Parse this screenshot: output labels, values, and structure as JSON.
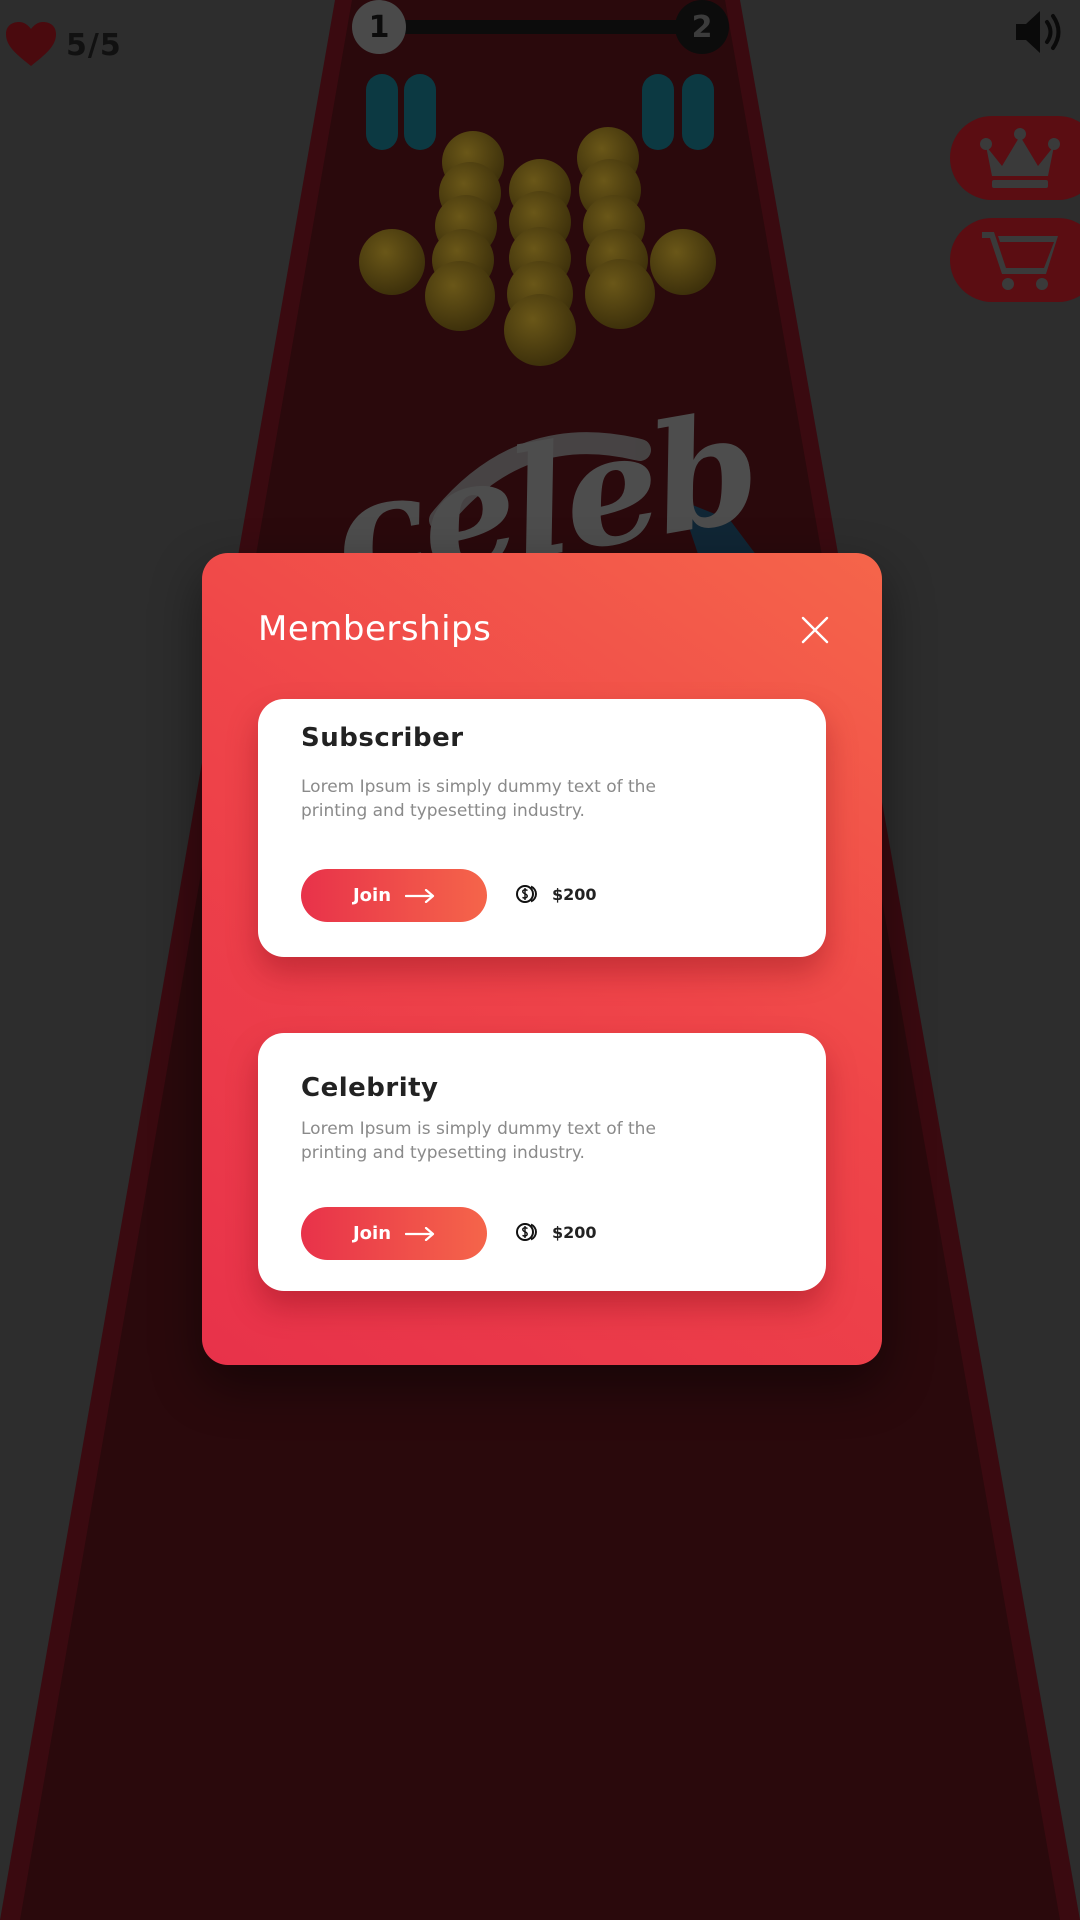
{
  "hud": {
    "lives": "5/5",
    "level_current": "1",
    "level_next": "2"
  },
  "background": {
    "logo_text": "celeb"
  },
  "modal": {
    "title": "Memberships",
    "cards": [
      {
        "title": "Subscriber",
        "description": "Lorem Ipsum is simply dummy text of the printing and typesetting industry.",
        "button_label": "Join",
        "price": "$200"
      },
      {
        "title": "Celebrity",
        "description": "Lorem Ipsum is simply dummy text of the printing and typesetting industry.",
        "button_label": "Join",
        "price": "$200"
      }
    ]
  },
  "icons": {
    "lives": "heart-icon",
    "sound": "speaker-icon",
    "membership": "crown-icon",
    "shop": "cart-icon",
    "close": "close-icon",
    "join": "arrow-right-icon",
    "price": "coin-icon"
  },
  "colors": {
    "accent_start": "#e8324a",
    "accent_end": "#f5654a",
    "track": "#2a090c",
    "backdrop": "#2d2d2d"
  }
}
